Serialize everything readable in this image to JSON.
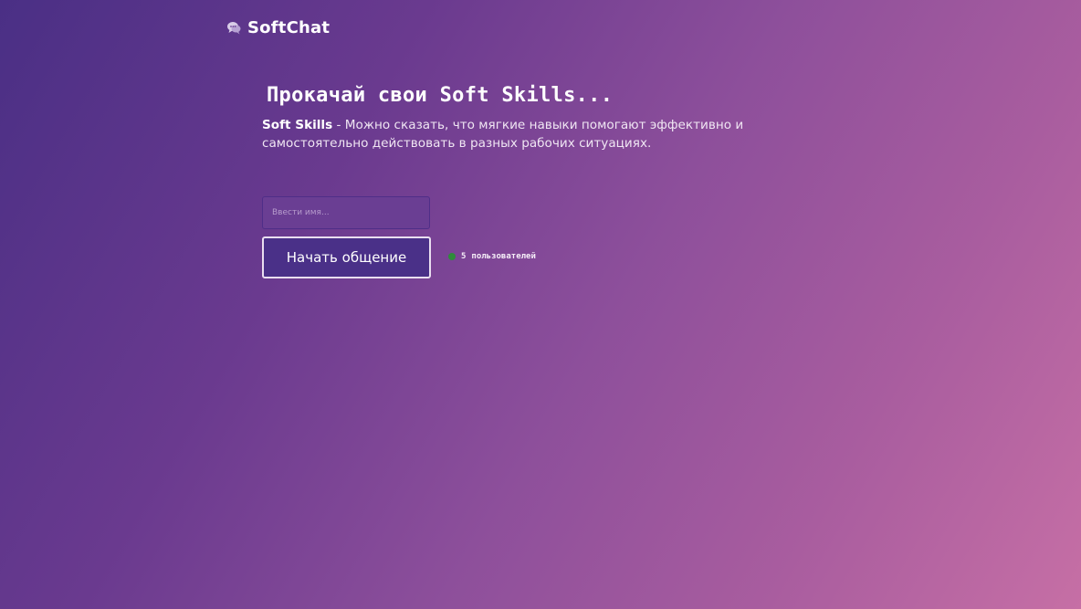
{
  "brand": {
    "name": "SoftChat",
    "icon": "chat-bubbles-icon"
  },
  "hero": {
    "title": "Прокачай свои Soft Skills...",
    "term": "Soft Skills",
    "description": " - Можно сказать, что мягкие навыки помогают эффективно и самостоятельно действовать в разных рабочих ситуациях."
  },
  "form": {
    "name_placeholder": "Ввести имя...",
    "name_value": "",
    "start_label": "Начать общение"
  },
  "online": {
    "count": "5",
    "label": "пользователей",
    "indicator": "status-dot-icon",
    "status_color": "#2e8b3a"
  },
  "colors": {
    "button_bg": "#4a3088",
    "button_border": "#e9def0",
    "input_bg": "#6a3e93"
  }
}
